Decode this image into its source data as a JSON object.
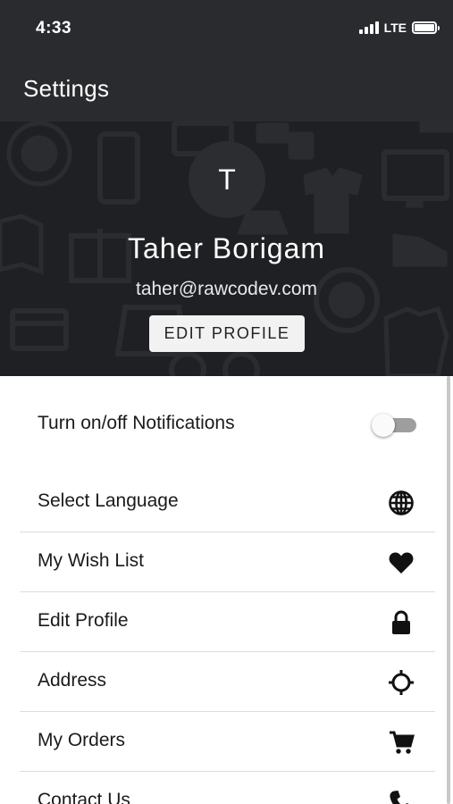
{
  "status_bar": {
    "time": "4:33",
    "network": "LTE"
  },
  "app_bar": {
    "title": "Settings"
  },
  "profile": {
    "avatar_initial": "T",
    "name": "Taher Borigam",
    "email": "taher@rawcodev.com",
    "edit_button_label": "EDIT PROFILE"
  },
  "notifications": {
    "label": "Turn on/off Notifications",
    "enabled": false
  },
  "menu": [
    {
      "label": "Select Language",
      "icon": "globe-icon"
    },
    {
      "label": "My Wish List",
      "icon": "heart-icon"
    },
    {
      "label": "Edit Profile",
      "icon": "lock-icon"
    },
    {
      "label": "Address",
      "icon": "location-crosshair-icon"
    },
    {
      "label": "My Orders",
      "icon": "cart-icon"
    },
    {
      "label": "Contact Us",
      "icon": "phone-icon"
    }
  ],
  "colors": {
    "app_bar": "#2a2b2f",
    "header_bg": "#1f2023",
    "text": "#1b1b1b",
    "divider": "#dcdcdc"
  }
}
